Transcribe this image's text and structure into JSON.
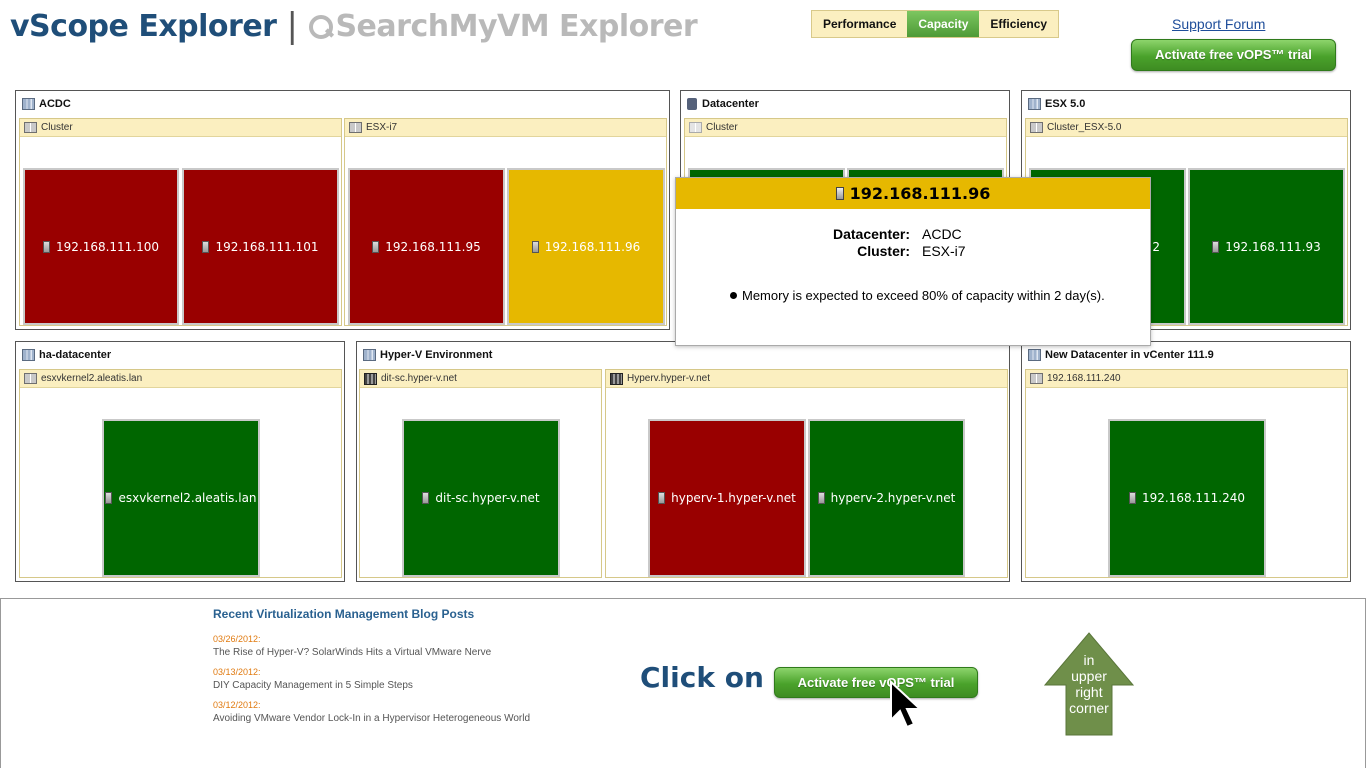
{
  "header": {
    "logo_main": "vScope Explorer",
    "logo_sep": "|",
    "logo_sub": "SearchMyVM Explorer",
    "tabs": [
      {
        "label": "Performance",
        "active": false
      },
      {
        "label": "Capacity",
        "active": true
      },
      {
        "label": "Efficiency",
        "active": false
      }
    ],
    "support_link": "Support Forum",
    "trial_button": "Activate free vOPS™ trial"
  },
  "colors": {
    "critical": "#990000",
    "ok": "#006600",
    "warning": "#e6b800",
    "group_header": "#fbefc0",
    "brand_blue": "#1f4e79"
  },
  "datacenters": [
    {
      "name": "ACDC",
      "icon": "datacenter-icon",
      "groups": [
        {
          "name": "Cluster",
          "hosts": [
            {
              "name": "192.168.111.100",
              "status": "critical"
            },
            {
              "name": "192.168.111.101",
              "status": "critical"
            }
          ]
        },
        {
          "name": "ESX-i7",
          "hosts": [
            {
              "name": "192.168.111.95",
              "status": "critical"
            },
            {
              "name": "192.168.111.96",
              "status": "warning"
            }
          ]
        }
      ]
    },
    {
      "name": "Datacenter",
      "icon": "database-icon",
      "groups": [
        {
          "name": "Cluster",
          "hosts": [
            {
              "name": "",
              "status": "ok"
            },
            {
              "name": "",
              "status": "ok"
            }
          ]
        }
      ]
    },
    {
      "name": "ESX 5.0",
      "icon": "datacenter-icon",
      "groups": [
        {
          "name": "Cluster_ESX-5.0",
          "hosts": [
            {
              "name": "2",
              "status": "ok"
            },
            {
              "name": "192.168.111.93",
              "status": "ok"
            }
          ]
        }
      ]
    },
    {
      "name": "ha-datacenter",
      "icon": "datacenter-icon",
      "groups": [
        {
          "name": "esxvkernel2.aleatis.lan",
          "hosts": [
            {
              "name": "esxvkernel2.aleatis.lan",
              "status": "ok"
            }
          ]
        }
      ]
    },
    {
      "name": "Hyper-V Environment",
      "icon": "datacenter-icon",
      "groups": [
        {
          "name": "dit-sc.hyper-v.net",
          "hosts": [
            {
              "name": "dit-sc.hyper-v.net",
              "status": "ok"
            }
          ]
        },
        {
          "name": "Hyperv.hyper-v.net",
          "hosts": [
            {
              "name": "hyperv-1.hyper-v.net",
              "status": "critical"
            },
            {
              "name": "hyperv-2.hyper-v.net",
              "status": "ok"
            }
          ]
        }
      ]
    },
    {
      "name": "New Datacenter in vCenter 111.9",
      "icon": "datacenter-icon",
      "groups": [
        {
          "name": "192.168.111.240",
          "hosts": [
            {
              "name": "192.168.111.240",
              "status": "ok"
            }
          ]
        }
      ]
    }
  ],
  "tooltip": {
    "title": "192.168.111.96",
    "rows": [
      {
        "label": "Datacenter:",
        "value": "ACDC"
      },
      {
        "label": "Cluster:",
        "value": "ESX-i7"
      }
    ],
    "message": "Memory is expected to exceed 80% of capacity within 2 day(s)."
  },
  "footer": {
    "blog_title": "Recent Virtualization Management Blog Posts",
    "posts": [
      {
        "date": "03/26/2012:",
        "title": "The Rise of Hyper-V? SolarWinds Hits a Virtual VMware Nerve"
      },
      {
        "date": "03/13/2012:",
        "title": "DIY Capacity Management in 5 Simple Steps"
      },
      {
        "date": "03/12/2012:",
        "title": "Avoiding VMware Vendor Lock-In in a Hypervisor Heterogeneous World"
      }
    ],
    "click_on": "Click on",
    "trial_button": "Activate free vOPS™ trial",
    "arrow_text": [
      "in",
      "upper",
      "right",
      "corner"
    ]
  }
}
